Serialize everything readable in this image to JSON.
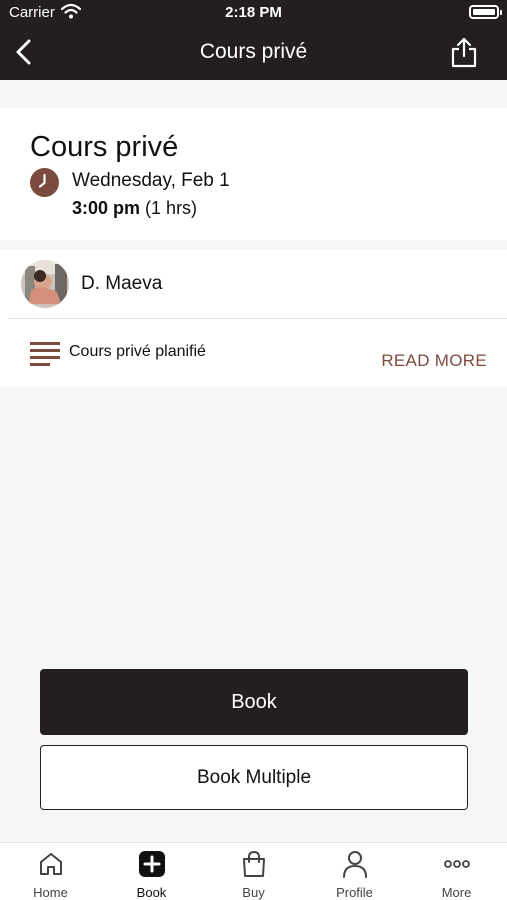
{
  "status_bar": {
    "carrier": "Carrier",
    "time": "2:18 PM"
  },
  "nav": {
    "title": "Cours privé"
  },
  "class": {
    "title": "Cours privé",
    "date": "Wednesday, Feb 1",
    "time": "3:00 pm",
    "duration": "(1 hrs)"
  },
  "instructor": {
    "name": "D. Maeva"
  },
  "description": {
    "text": "Cours privé planifié",
    "read_more": "READ MORE"
  },
  "actions": {
    "book": "Book",
    "book_multiple": "Book Multiple"
  },
  "tabs": [
    {
      "label": "Home",
      "icon": "home-icon"
    },
    {
      "label": "Book",
      "icon": "plus-square-icon",
      "active": true
    },
    {
      "label": "Buy",
      "icon": "shopping-bag-icon"
    },
    {
      "label": "Profile",
      "icon": "person-icon"
    },
    {
      "label": "More",
      "icon": "more-dots-icon"
    }
  ],
  "colors": {
    "header": "#231f20",
    "accent": "#7b4a3e",
    "background": "#f5f6f8"
  }
}
